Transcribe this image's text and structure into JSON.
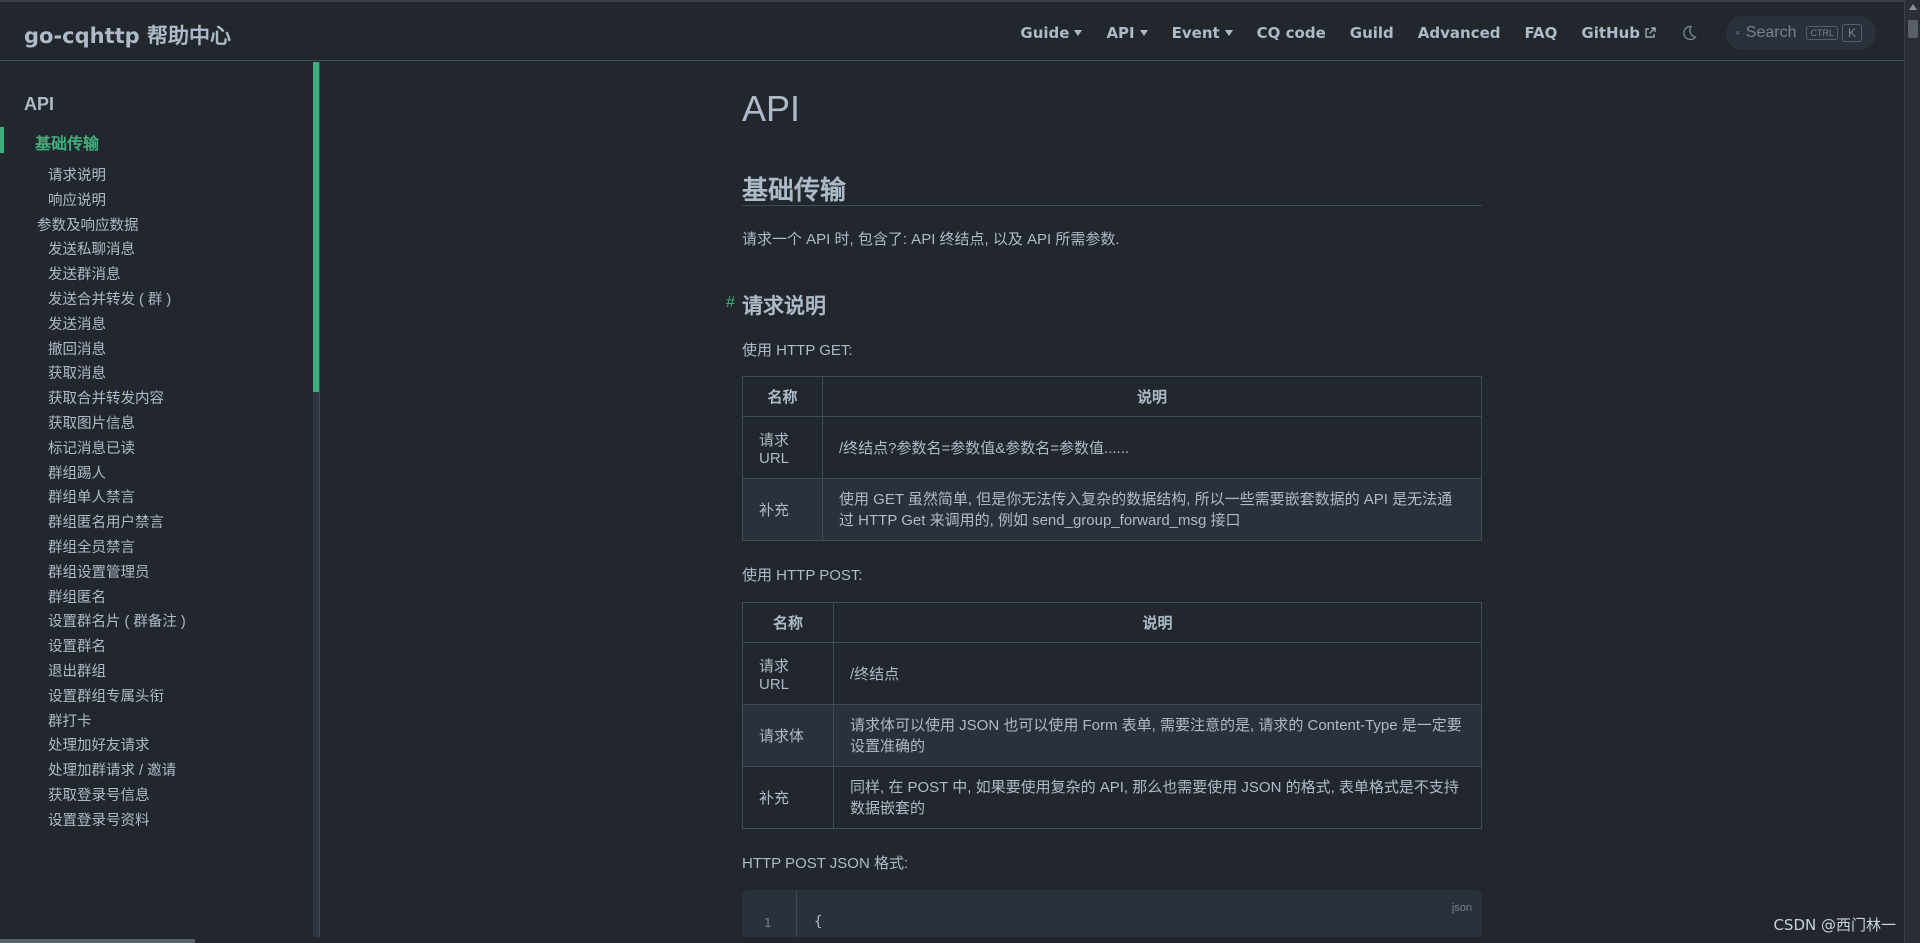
{
  "navbar": {
    "title": "go-cqhttp 帮助中心",
    "items": [
      {
        "label": "Guide",
        "dropdown": true
      },
      {
        "label": "API",
        "dropdown": true
      },
      {
        "label": "Event",
        "dropdown": true
      },
      {
        "label": "CQ code",
        "dropdown": false
      },
      {
        "label": "Guild",
        "dropdown": false
      },
      {
        "label": "Advanced",
        "dropdown": false
      },
      {
        "label": "FAQ",
        "dropdown": false
      },
      {
        "label": "GitHub",
        "dropdown": false,
        "external": true
      }
    ],
    "search_placeholder": "Search",
    "kbd_ctrl": "CTRL",
    "kbd_k": "K"
  },
  "sidebar": {
    "heading": "API",
    "active_item": "基础传输",
    "items": [
      {
        "label": "请求说明",
        "level": 2
      },
      {
        "label": "响应说明",
        "level": 2
      },
      {
        "label": "参数及响应数据",
        "level": 1
      },
      {
        "label": "发送私聊消息",
        "level": 2
      },
      {
        "label": "发送群消息",
        "level": 2
      },
      {
        "label": "发送合并转发 ( 群 )",
        "level": 2
      },
      {
        "label": "发送消息",
        "level": 2
      },
      {
        "label": "撤回消息",
        "level": 2
      },
      {
        "label": "获取消息",
        "level": 2
      },
      {
        "label": "获取合并转发内容",
        "level": 2
      },
      {
        "label": "获取图片信息",
        "level": 2
      },
      {
        "label": "标记消息已读",
        "level": 2
      },
      {
        "label": "群组踢人",
        "level": 2
      },
      {
        "label": "群组单人禁言",
        "level": 2
      },
      {
        "label": "群组匿名用户禁言",
        "level": 2
      },
      {
        "label": "群组全员禁言",
        "level": 2
      },
      {
        "label": "群组设置管理员",
        "level": 2
      },
      {
        "label": "群组匿名",
        "level": 2
      },
      {
        "label": "设置群名片 ( 群备注 )",
        "level": 2
      },
      {
        "label": "设置群名",
        "level": 2
      },
      {
        "label": "退出群组",
        "level": 2
      },
      {
        "label": "设置群组专属头衔",
        "level": 2
      },
      {
        "label": "群打卡",
        "level": 2
      },
      {
        "label": "处理加好友请求",
        "level": 2
      },
      {
        "label": "处理加群请求 / 邀请",
        "level": 2
      },
      {
        "label": "获取登录号信息",
        "level": 2
      },
      {
        "label": "设置登录号资料",
        "level": 2
      }
    ]
  },
  "content": {
    "h1": "API",
    "h2": "基础传输",
    "intro": "请求一个 API 时, 包含了: API 终结点, 以及 API 所需参数.",
    "anchor": "#",
    "h3": "请求说明",
    "get_label": "使用 HTTP GET:",
    "table_get": {
      "headers": [
        "名称",
        "说明"
      ],
      "rows": [
        [
          "请求 URL",
          "/终结点?参数名=参数值&参数名=参数值......"
        ],
        [
          "补充",
          "使用 GET 虽然简单, 但是你无法传入复杂的数据结构, 所以一些需要嵌套数据的 API 是无法通过 HTTP Get 来调用的, 例如 send_group_forward_msg 接口"
        ]
      ]
    },
    "post_label": "使用 HTTP POST:",
    "table_post": {
      "headers": [
        "名称",
        "说明"
      ],
      "rows": [
        [
          "请求 URL",
          "/终结点"
        ],
        [
          "请求体",
          "请求体可以使用 JSON 也可以使用 Form 表单, 需要注意的是, 请求的 Content-Type 是一定要设置准确的"
        ],
        [
          "补充",
          "同样, 在 POST 中, 如果要使用复杂的 API, 那么也需要使用 JSON 的格式, 表单格式是不支持数据嵌套的"
        ]
      ]
    },
    "json_label": "HTTP POST JSON 格式:",
    "code": {
      "lang": "json",
      "line_no": "1",
      "line": "{"
    }
  },
  "watermark": "CSDN @西门林一",
  "colors": {
    "accent": "#3eaf7c",
    "background": "#22272e",
    "text": "#adbac7",
    "border": "#3e4c5a"
  }
}
